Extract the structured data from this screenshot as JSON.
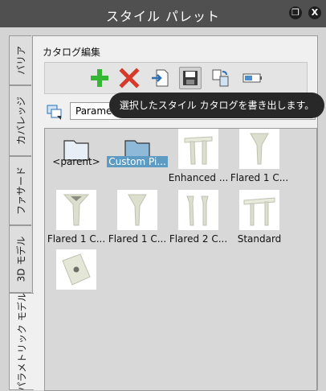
{
  "window": {
    "title": "スタイル パレット",
    "restore_glyph": "❐",
    "close_glyph": "X"
  },
  "tabs": [
    {
      "label": "バリア",
      "active": false
    },
    {
      "label": "カバレッジ",
      "active": false
    },
    {
      "label": "ファサード",
      "active": false
    },
    {
      "label": "3D モデル",
      "active": false
    },
    {
      "label": "パラメトリック モデル",
      "active": true
    }
  ],
  "section": {
    "title": "カタログ編集"
  },
  "toolbar": {
    "buttons": [
      {
        "name": "add-icon",
        "pressed": false
      },
      {
        "name": "delete-icon",
        "pressed": false
      },
      {
        "name": "import-icon",
        "pressed": false
      },
      {
        "name": "save-icon",
        "pressed": true
      },
      {
        "name": "copy-icon",
        "pressed": false
      },
      {
        "name": "battery-icon",
        "pressed": false
      }
    ]
  },
  "catalog_path": "Parametric Models/ Bridge/ Piers",
  "tooltip": "選択したスタイル カタログを書き出します。",
  "items": [
    {
      "caption": "<parent>",
      "kind": "folder",
      "selected": false
    },
    {
      "caption": "Custom Pi...",
      "kind": "folder",
      "selected": true
    },
    {
      "caption": "Enhanced ...",
      "kind": "pier-enhanced",
      "selected": false
    },
    {
      "caption": "Flared 1 C...",
      "kind": "pier-flared",
      "selected": false
    },
    {
      "caption": "Flared 1 C...",
      "kind": "pier-flared-wide",
      "selected": false
    },
    {
      "caption": "Flared 1 C...",
      "kind": "pier-flared",
      "selected": false
    },
    {
      "caption": "Flared 2 C...",
      "kind": "pier-two",
      "selected": false
    },
    {
      "caption": "Standard",
      "kind": "pier-standard",
      "selected": false
    },
    {
      "caption": "",
      "kind": "plate",
      "selected": false
    }
  ]
}
